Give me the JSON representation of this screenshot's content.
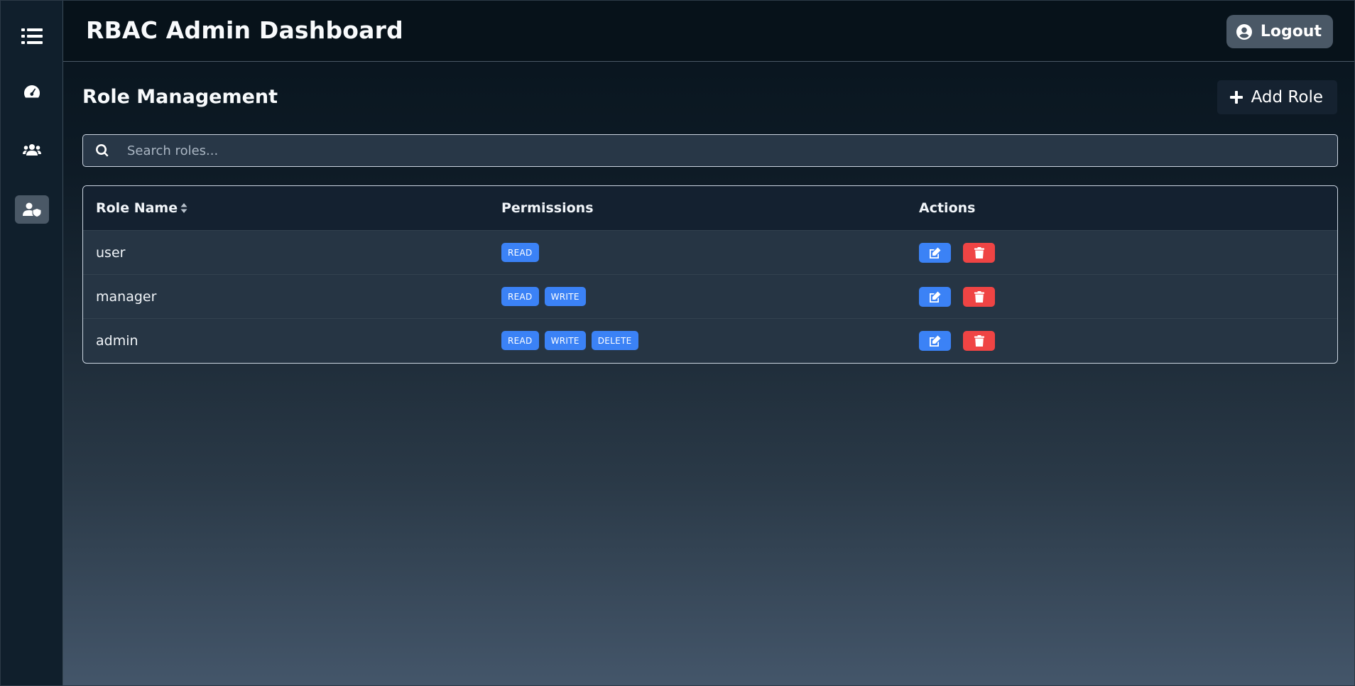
{
  "header": {
    "title": "RBAC Admin Dashboard",
    "logout_label": "Logout"
  },
  "sidebar": {
    "items": [
      {
        "icon": "list-icon",
        "active": false
      },
      {
        "icon": "dashboard-gauge-icon",
        "active": false
      },
      {
        "icon": "users-icon",
        "active": false
      },
      {
        "icon": "user-shield-icon",
        "active": true
      }
    ]
  },
  "main": {
    "title": "Role Management",
    "add_role_label": "Add Role",
    "search_placeholder": "Search roles...",
    "search_value": ""
  },
  "table": {
    "headers": {
      "role_name": "Role Name",
      "permissions": "Permissions",
      "actions": "Actions"
    },
    "rows": [
      {
        "name": "user",
        "permissions": [
          "READ"
        ]
      },
      {
        "name": "manager",
        "permissions": [
          "READ",
          "WRITE"
        ]
      },
      {
        "name": "admin",
        "permissions": [
          "READ",
          "WRITE",
          "DELETE"
        ]
      }
    ]
  },
  "colors": {
    "accent": "#3b82f6",
    "danger": "#ef4444",
    "sidebar_active": "#4a5866"
  }
}
